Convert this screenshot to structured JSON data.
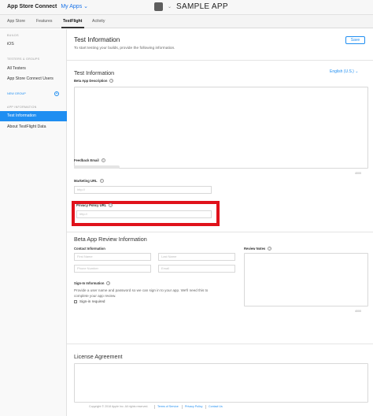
{
  "header": {
    "brand": "App Store Connect",
    "my_apps": "My Apps",
    "my_apps_chevron": "⌄",
    "app_chevron": "⌄",
    "app_name": "SAMPLE APP"
  },
  "tabs": [
    "App Store",
    "Features",
    "TestFlight",
    "Activity"
  ],
  "sidebar": {
    "builds_heading": "BUILDS",
    "ios": "iOS",
    "testers_heading": "TESTERS & GROUPS",
    "all_testers": "All Testers",
    "asc_users": "App Store Connect Users",
    "new_group": "NEW GROUP",
    "app_info_heading": "APP INFORMATION",
    "test_information": "Test Information",
    "about_data": "About TestFlight Data"
  },
  "main": {
    "title": "Test Information",
    "subtitle": "To start testing your builds, provide the following information.",
    "save": "Save",
    "section_test_info": "Test Information",
    "language": "English (U.S.) ⌄",
    "beta_desc_label": "Beta App Description",
    "beta_desc_counter": "4000",
    "feedback_email_label": "Feedback Email",
    "marketing_url_label": "Marketing URL",
    "marketing_url_placeholder": "http://",
    "privacy_url_label": "Privacy Policy URL",
    "privacy_url_placeholder": "http://",
    "review_section": "Beta App Review Information",
    "contact_label": "Contact Information",
    "first_name": "First Name",
    "last_name": "Last Name",
    "phone": "Phone Number",
    "email": "Email",
    "review_notes_label": "Review Notes",
    "review_notes_counter": "4000",
    "signin_label": "Sign-In Information",
    "signin_desc_1": "Provide a user name and password so we can sign in to your app. We'll need this to",
    "signin_desc_2": "complete your app review.",
    "signin_required": "Sign-in required",
    "license_section": "License Agreement",
    "help": "?",
    "plus": "+"
  },
  "footer": {
    "copyright": "Copyright © 2018 Apple Inc. All rights reserved.",
    "terms": "Terms of Service",
    "privacy": "Privacy Policy",
    "contact": "Contact Us"
  }
}
